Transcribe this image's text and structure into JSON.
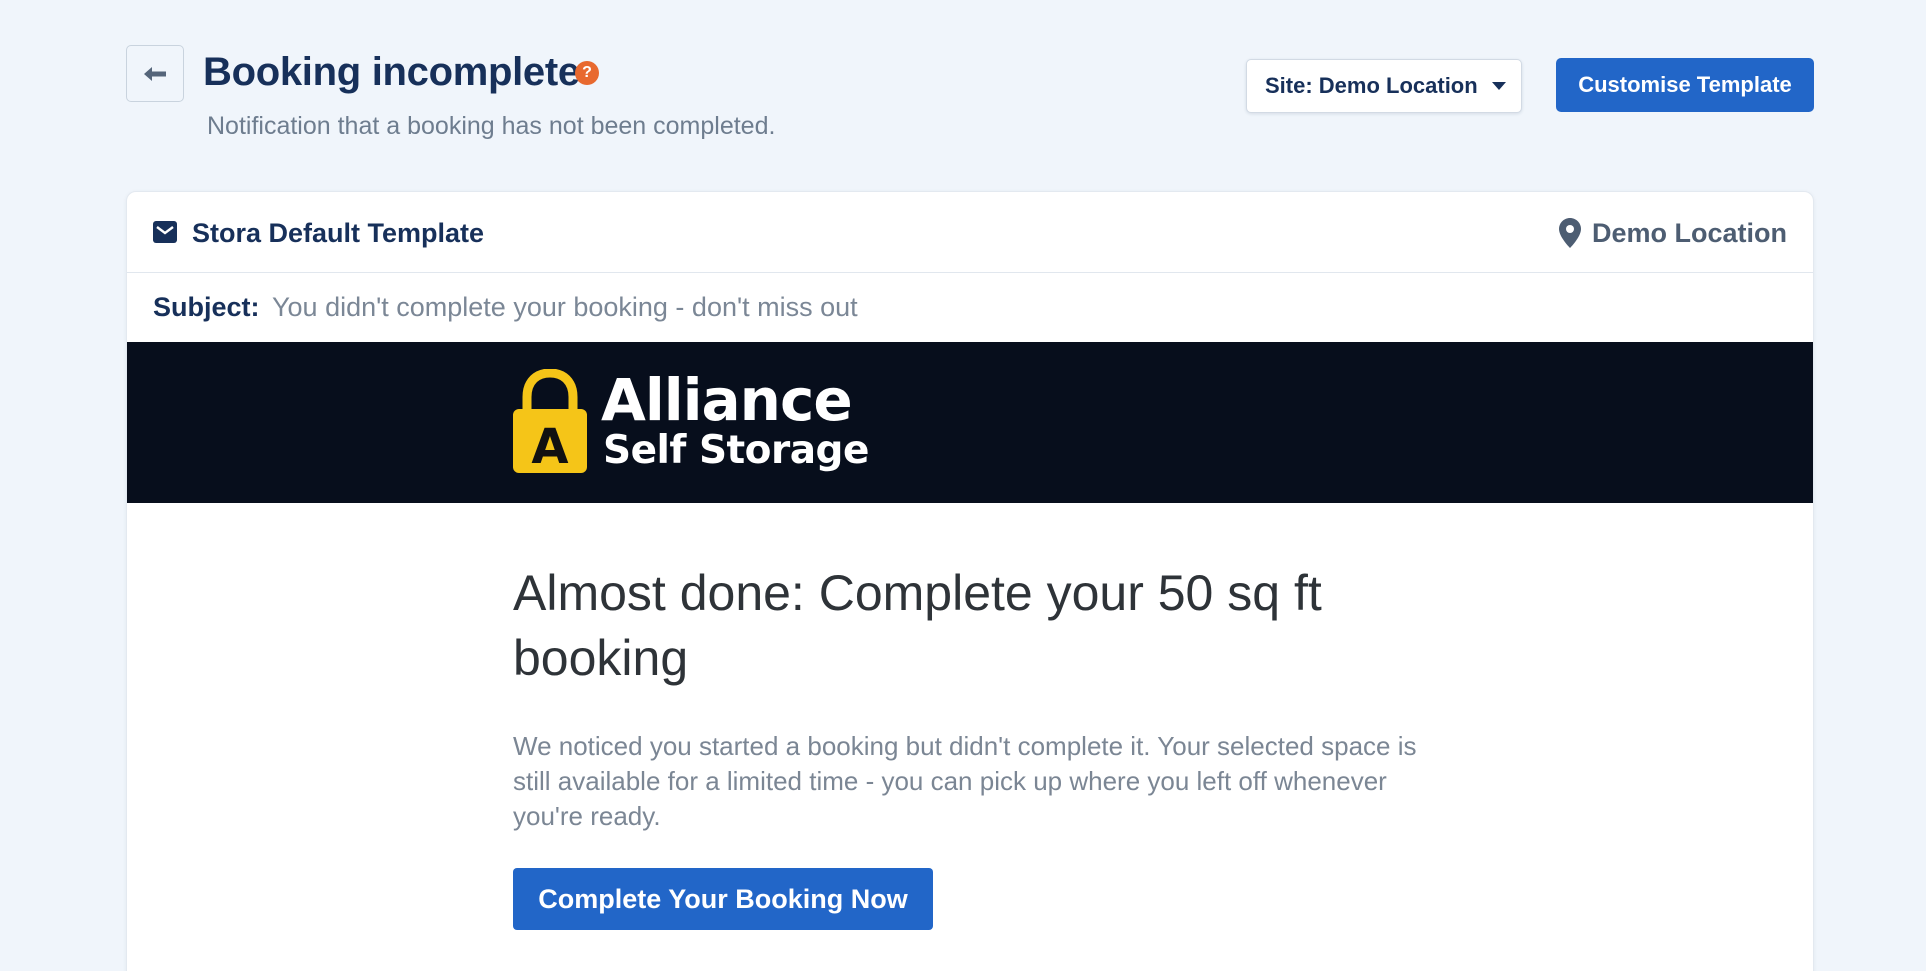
{
  "header": {
    "title": "Booking incomplete",
    "help_icon": "question-circle-icon",
    "help_glyph": "?",
    "subtitle": "Notification that a booking has not been completed.",
    "back_icon": "arrow-left-icon",
    "site_select": {
      "value": "Site: Demo Location"
    },
    "customise_label": "Customise Template"
  },
  "card": {
    "template_icon": "envelope-icon",
    "template_name": "Stora Default Template",
    "location_icon": "map-pin-icon",
    "location_name": "Demo Location",
    "subject_label": "Subject:",
    "subject_value": "You didn't complete your booking - don't miss out"
  },
  "email": {
    "logo": {
      "word1": "Alliance",
      "word2": "Self Storage",
      "badge_letter": "A"
    },
    "heading": "Almost done: Complete your 50 sq ft booking",
    "body": "We noticed you started a booking but didn't complete it. Your selected space is still available for a limited time - you can pick up where you left off whenever you're ready.",
    "cta_label": "Complete Your Booking Now"
  },
  "colors": {
    "page_bg": "#f0f5fb",
    "primary": "#2266c8",
    "title": "#17305a",
    "help": "#e8692f",
    "banner_bg": "#070e1c",
    "logo_yellow": "#f5c518"
  }
}
